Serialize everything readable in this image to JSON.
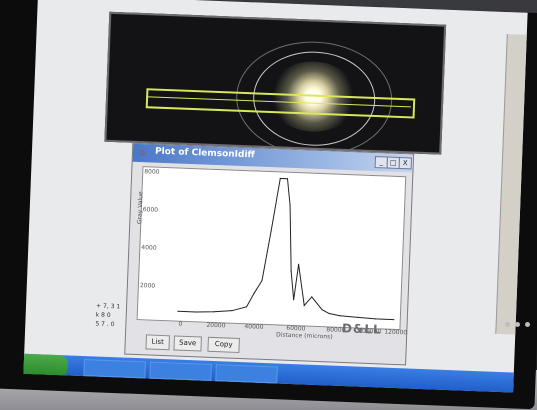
{
  "window": {
    "title": "Plot of ClemsonIdiff"
  },
  "window_buttons": {
    "minimize": "_",
    "maximize": "□",
    "close": "X"
  },
  "plot": {
    "y_ticks": [
      "8000",
      "6000",
      "4000",
      "2000"
    ],
    "x_ticks": [
      "0",
      "20000",
      "40000",
      "60000",
      "80000",
      "100000",
      "120000"
    ],
    "xlabel": "Distance (microns)",
    "ylabel": "Gray Value"
  },
  "buttons": {
    "list": "List",
    "save": "Save",
    "copy": "Copy"
  },
  "side_text": [
    "+ 7, 3 1",
    "k 8 0",
    "5 7 . 0"
  ],
  "monitor": {
    "logo": "D&LL"
  },
  "chart_data": {
    "type": "line",
    "x": [
      0,
      10000,
      20000,
      30000,
      38000,
      42000,
      46000,
      50000,
      54000,
      56000,
      58000,
      60000,
      62000,
      64000,
      66000,
      70000,
      74000,
      80000,
      84000,
      90000,
      100000,
      110000,
      120000
    ],
    "y": [
      300,
      300,
      350,
      450,
      700,
      1500,
      2200,
      5000,
      8000,
      8000,
      8000,
      6500,
      2800,
      1200,
      3200,
      900,
      1400,
      700,
      500,
      400,
      350,
      300,
      300
    ],
    "xlim": [
      0,
      120000
    ],
    "ylim": [
      0,
      8000
    ],
    "xlabel": "Distance (microns)",
    "ylabel": "Gray Value",
    "grid": false
  }
}
